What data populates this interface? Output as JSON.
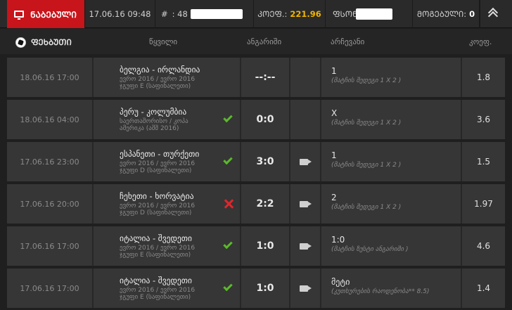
{
  "topbar": {
    "tab_label": "ᲜᲐᲑᲔᲑᲣᲚᲘ",
    "date": "17.06.16 09:48",
    "id_prefix": "#",
    "id_partial": ": 48",
    "coef_label": "ᲙᲝᲔᲤ.:",
    "coef_value": "221.96",
    "stake_label": "ᲤᲡᲝᲜ",
    "win_label": "ᲛᲝᲒᲔᲑᲣᲚᲘ:",
    "win_value": "0"
  },
  "header": {
    "sport": "ᲤᲔᲮᲑᲣᲗᲘ",
    "event": "წყვილი",
    "score": "ანგარიში",
    "pick": "არჩევანი",
    "odds": "კოეფ."
  },
  "rows": [
    {
      "date": "18.06.16 17:00",
      "event": "ბელგია - ირლანდია",
      "sub1": "ევრო 2016 / ევრო 2016",
      "sub2": "ჯგუფი E (საფინალეთი)",
      "status": "none",
      "score": "--:--",
      "video": false,
      "pick": "1",
      "pick_sub": "(მატჩის შედეგი 1 X 2 )",
      "odds": "1.8"
    },
    {
      "date": "18.06.16 04:00",
      "event": "პერუ - კოლუმბია",
      "sub1": "საერთაშორისო / კოპა",
      "sub2": "ამერიკა (აშშ 2016)",
      "status": "won",
      "score": "0:0",
      "video": false,
      "pick": "X",
      "pick_sub": "(მატჩის შედეგი 1 X 2 )",
      "odds": "3.6"
    },
    {
      "date": "17.06.16 23:00",
      "event": "ესპანეთი - თურქეთი",
      "sub1": "ევრო 2016 / ევრო 2016",
      "sub2": "ჯგუფი D (საფინალეთი)",
      "status": "won",
      "score": "3:0",
      "video": true,
      "pick": "1",
      "pick_sub": "(მატჩის შედეგი 1 X 2 )",
      "odds": "1.5"
    },
    {
      "date": "17.06.16 20:00",
      "event": "ჩეხეთი - ხორვატია",
      "sub1": "ევრო 2016 / ევრო 2016",
      "sub2": "ჯგუფი D (საფინალეთი)",
      "status": "lost",
      "score": "2:2",
      "video": true,
      "pick": "2",
      "pick_sub": "(მატჩის შედეგი 1 X 2 )",
      "odds": "1.97"
    },
    {
      "date": "17.06.16 17:00",
      "event": "იტალია - შვედეთი",
      "sub1": "ევრო 2016 / ევრო 2016",
      "sub2": "ჯგუფი E (საფინალეთი)",
      "status": "won",
      "score": "1:0",
      "video": true,
      "pick": "1:0",
      "pick_sub": "(მატჩის ზუსტი ანგარიში )",
      "odds": "4.6"
    },
    {
      "date": "17.06.16 17:00",
      "event": "იტალია - შვედეთი",
      "sub1": "ევრო 2016 / ევრო 2016",
      "sub2": "ჯგუფი E (საფინალეთი)",
      "status": "won",
      "score": "1:0",
      "video": true,
      "pick": "მეტი",
      "pick_sub": "(კუთხურების რაოდენობა** 8.5)",
      "odds": "1.4"
    }
  ],
  "colors": {
    "accent": "#c8141b",
    "coef": "#f0b400",
    "won": "#5cb82e",
    "lost": "#e0262c"
  },
  "icons": {
    "tab": "monitor-icon",
    "sport": "soccer-ball-icon",
    "collapse": "double-chevron-up-icon",
    "video": "video-camera-icon",
    "won": "check-icon",
    "lost": "cross-icon"
  }
}
